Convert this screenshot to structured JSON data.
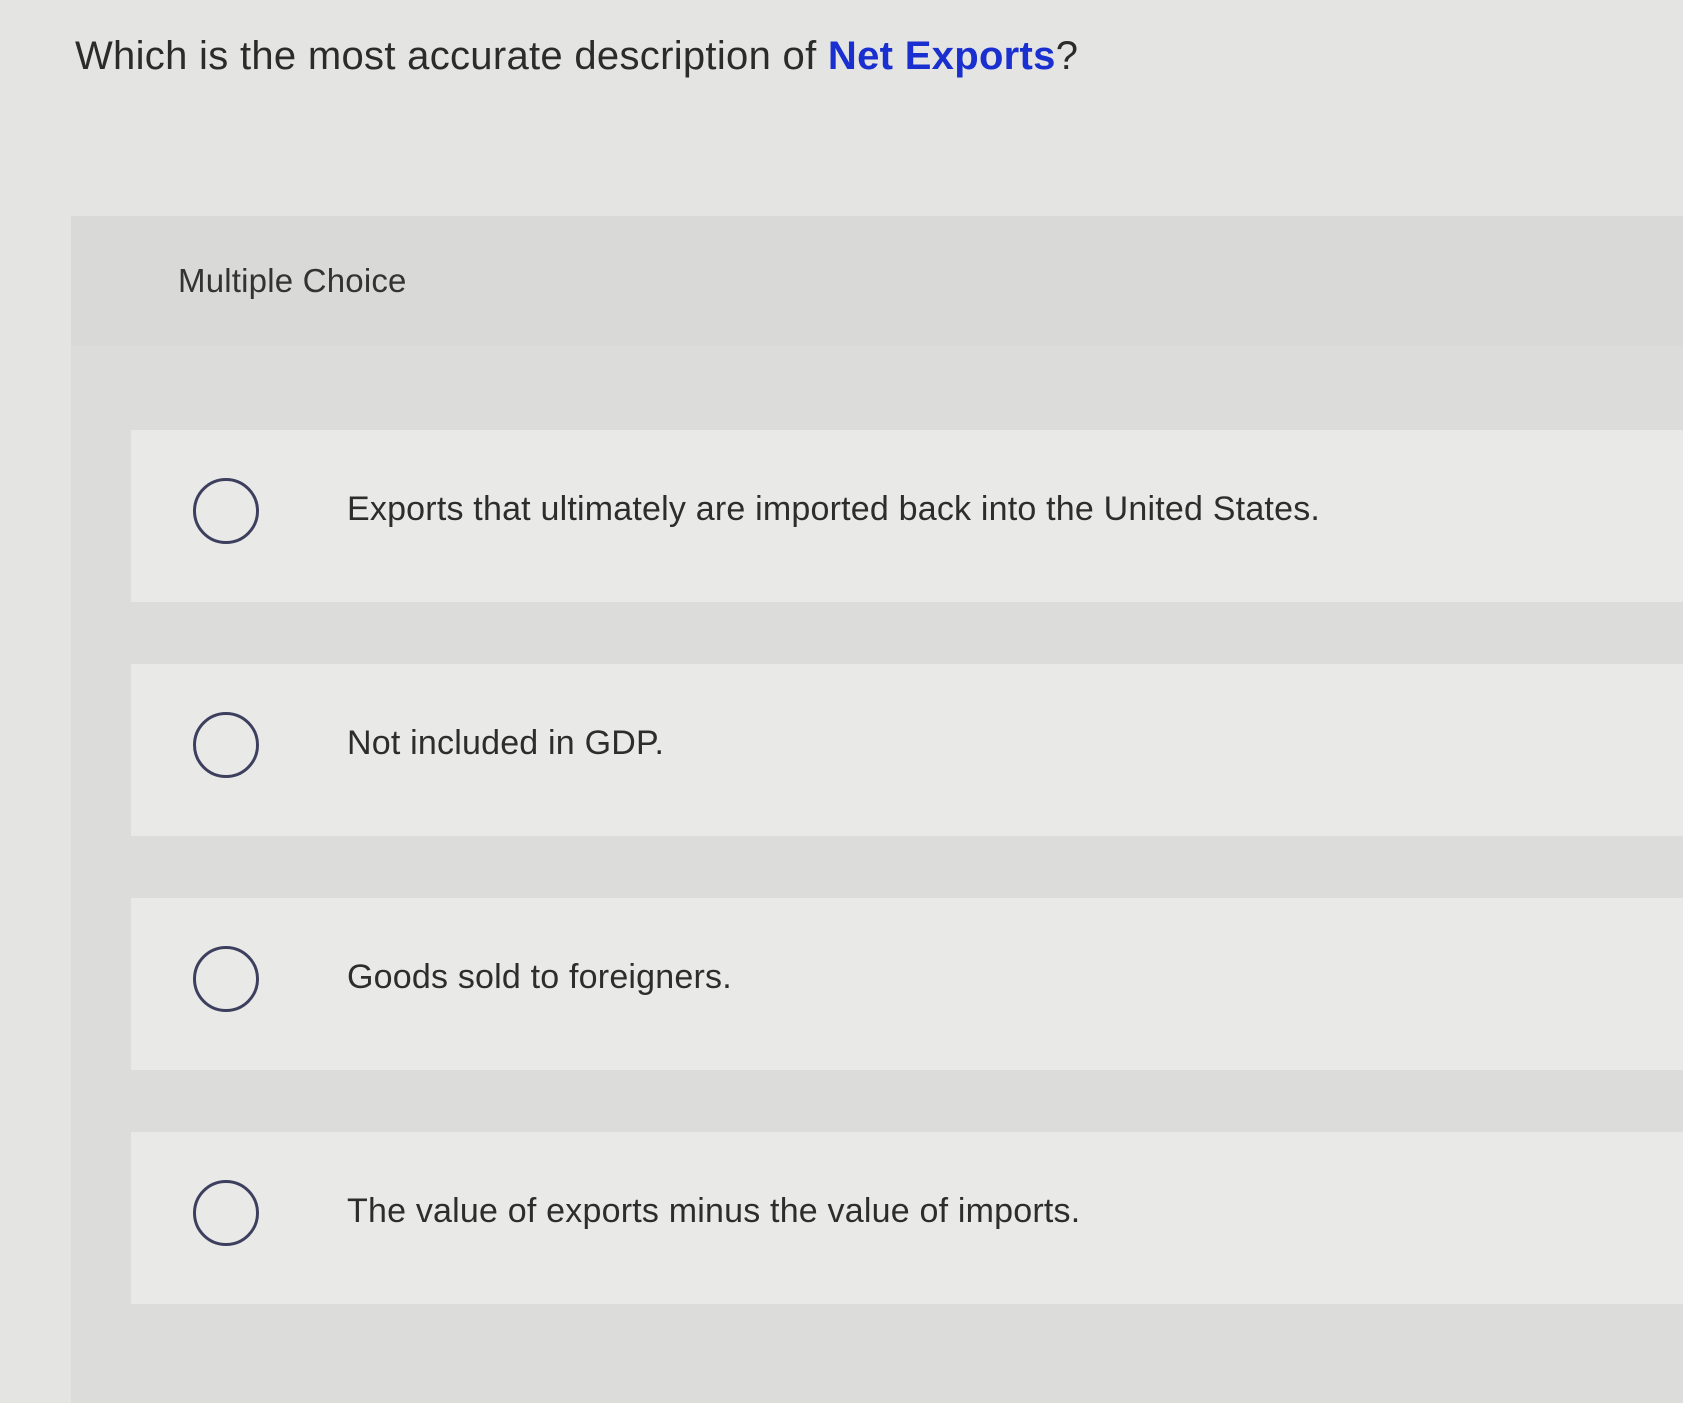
{
  "question": {
    "prefix": "Which is the most accurate description of ",
    "term": "Net Exports",
    "suffix": "?"
  },
  "multiple_choice": {
    "title": "Multiple Choice",
    "options": [
      {
        "label": "Exports that ultimately are imported back into the United States.",
        "selected": false
      },
      {
        "label": "Not included in GDP.",
        "selected": false
      },
      {
        "label": "Goods sold to foreigners.",
        "selected": false
      },
      {
        "label": "The value of exports minus the value of imports.",
        "selected": false
      }
    ]
  },
  "colors": {
    "term_highlight": "#1a2fd0",
    "radio_border": "#3d3f5e",
    "background": "#e4e4e2"
  }
}
